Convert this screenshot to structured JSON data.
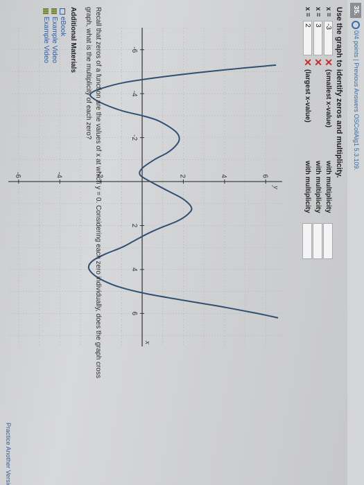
{
  "header": {
    "question_number": "35.",
    "points": "0/4 points",
    "separator": "|",
    "answers_link": "Previous Answers",
    "reference": "OSCollAlg1 5.3.109."
  },
  "question": {
    "prompt": "Use the graph to identify zeros and multiplicity.",
    "rows": [
      {
        "label": "x =",
        "value": "-3",
        "note": "(smallest x-value)",
        "mult_label": "with multiplicity"
      },
      {
        "label": "x =",
        "value": "3",
        "note": "",
        "mult_label": "with multiplicity"
      },
      {
        "label": "x =",
        "value": "2",
        "note": "(largest x-value)",
        "mult_label": "with multiplicity"
      }
    ],
    "wrong_mark": "✕",
    "mark_color": "#cc2a1f"
  },
  "chart_data": {
    "type": "line",
    "xlim": [
      -7,
      7.5
    ],
    "ylim": [
      -6.5,
      6.8
    ],
    "x_label": "x",
    "y_label": "y",
    "x_ticks": [
      "-6",
      "-4",
      "-2",
      "2",
      "4",
      "6"
    ],
    "y_ticks": [
      "6",
      "4",
      "2",
      "-2",
      "-4",
      "-6"
    ],
    "curve_color": "#2f4f73",
    "series": [
      {
        "x": [
          -5.3,
          -5.1,
          -4.8,
          -4.5,
          -4.2,
          -4.0,
          -3.8,
          -3.5,
          -3.2,
          -3.0,
          -2.8,
          -2.5,
          -2.2,
          -1.9,
          -1.6,
          -1.3,
          -1.0,
          -0.6,
          -0.3,
          0.0,
          0.4,
          0.8,
          1.2,
          1.5,
          1.8,
          2.1,
          2.4,
          2.7,
          3.0,
          3.3,
          3.6,
          3.9,
          4.2,
          4.5,
          4.8,
          5.1,
          5.4,
          5.7,
          6.0,
          6.2
        ],
        "y": [
          6.5,
          4.2,
          1.3,
          -0.9,
          -2.1,
          -2.5,
          -2.4,
          -1.8,
          -0.9,
          0.0,
          0.7,
          1.3,
          1.7,
          1.8,
          1.6,
          1.2,
          0.6,
          0.0,
          -0.1,
          0.4,
          1.2,
          2.0,
          2.4,
          2.2,
          1.7,
          0.9,
          0.2,
          -0.4,
          -1.0,
          -1.8,
          -2.4,
          -2.6,
          -2.4,
          -1.9,
          -1.1,
          0.2,
          2.0,
          3.9,
          5.6,
          6.6
        ]
      }
    ]
  },
  "instructions": {
    "recall_line_1": "Recall that zeros of a function are the values of x at which y = 0. Considering each zero individually, does the graph cross",
    "recall_line_2": "graph, what is the multiplicity of each zero?"
  },
  "materials": {
    "heading": "Additional Materials",
    "items": [
      {
        "label": "eBook",
        "icon": "ebook-icon"
      },
      {
        "label": "Example Video",
        "icon": "video-icon"
      },
      {
        "label": "Example Video",
        "icon": "video-icon"
      }
    ]
  },
  "footer": {
    "link": "Practice Another Version"
  }
}
